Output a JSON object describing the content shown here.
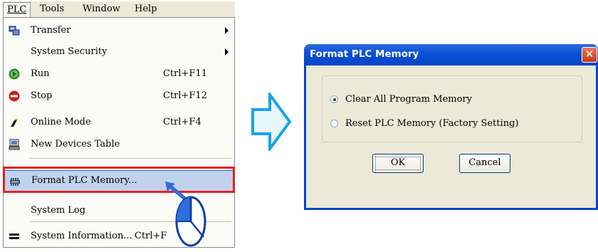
{
  "menubar": {
    "plc": "PLC",
    "tools": "Tools",
    "window": "Window",
    "help": "Help"
  },
  "menu": {
    "items": [
      {
        "label": "Transfer",
        "icon": "transfer-icon",
        "submenu": true
      },
      {
        "label": "System Security",
        "submenu": true
      },
      {
        "label": "Run",
        "shortcut": "Ctrl+F11",
        "icon": "run-icon"
      },
      {
        "label": "Stop",
        "shortcut": "Ctrl+F12",
        "icon": "stop-icon"
      },
      {
        "label": "Online Mode",
        "shortcut": "Ctrl+F4",
        "icon": "online-mode-icon"
      },
      {
        "label": "New Devices Table",
        "icon": "devices-table-icon"
      },
      {
        "label": "Format PLC Memory...",
        "icon": "format-memory-icon",
        "highlighted": true
      },
      {
        "label": "System Log"
      },
      {
        "label": "System Information...",
        "shortcut": "Ctrl+F",
        "icon": "system-info-icon"
      }
    ]
  },
  "dialog": {
    "title": "Format PLC Memory",
    "options": [
      {
        "label": "Clear All Program Memory",
        "selected": true
      },
      {
        "label": "Reset PLC Memory (Factory Setting)",
        "selected": false
      }
    ],
    "ok_label": "OK",
    "cancel_label": "Cancel"
  },
  "colors": {
    "highlight_box": "#e8201d",
    "menu_highlight": "#c1d2ee",
    "arrow_fill": "#e6f7fc",
    "arrow_stroke": "#1aa3e8",
    "titlebar": "#0a4fd4"
  }
}
